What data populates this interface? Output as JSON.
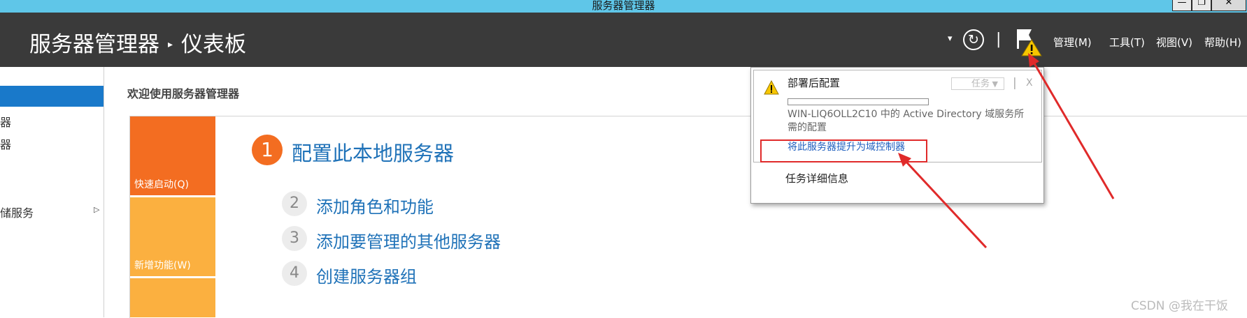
{
  "window": {
    "title": "服务器管理器",
    "minimize_glyph": "—",
    "restore_glyph": "❐",
    "close_glyph": "✕"
  },
  "header": {
    "app_name": "服务器管理器",
    "crumb_separator": "▸",
    "page_title": "仪表板",
    "dropdown_glyph": "▾",
    "refresh_glyph": "↻",
    "separator_glyph": "|",
    "menu": [
      "管理(M)",
      "工具(T)",
      "视图(V)",
      "帮助(H)"
    ]
  },
  "sidebar": {
    "items": [
      "器",
      "器",
      "储服务"
    ],
    "expand_glyph": "▷"
  },
  "main": {
    "welcome": "欢迎使用服务器管理器",
    "tiles": [
      "快速启动(Q)",
      "新增功能(W)",
      ""
    ],
    "steps": [
      {
        "num": "1",
        "label": "配置此本地服务器"
      },
      {
        "num": "2",
        "label": "添加角色和功能"
      },
      {
        "num": "3",
        "label": "添加要管理的其他服务器"
      },
      {
        "num": "4",
        "label": "创建服务器组"
      }
    ]
  },
  "notification": {
    "title": "部署后配置",
    "task_dropdown": "任务",
    "dropdown_glyph": "▼",
    "close_glyph": "X",
    "separator_glyph": "|",
    "progress": 0,
    "description": "WIN-LIQ6OLL2C10 中的 Active Directory 域服务所需的配置",
    "link": "将此服务器提升为域控制器",
    "details": "任务详细信息"
  },
  "watermark": "CSDN @我在干饭",
  "colors": {
    "title_bar": "#5fc6e8",
    "header_bg": "#3a3a3a",
    "nav_selected": "#1979ca",
    "quick_start_tile": "#f36d21",
    "whats_new_tile": "#fbb040",
    "link": "#1f72b8",
    "annotation_red": "#e02a2a",
    "warning": "#f7c600"
  }
}
